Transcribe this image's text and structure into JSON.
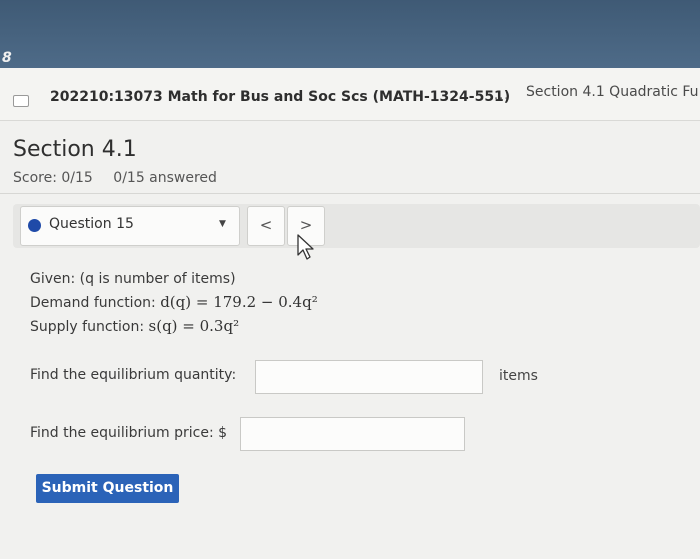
{
  "topbar": {
    "badge": "8"
  },
  "breadcrumb": {
    "course_title": "202210:13073 Math for Bus and Soc Scs (MATH-1324-551)",
    "dots": "...",
    "section": "Section 4.1 Quadratic Fu"
  },
  "page": {
    "title": "Section 4.1",
    "score": "Score: 0/15",
    "answered": "0/15 answered"
  },
  "question_nav": {
    "selected": "Question 15",
    "prev": "<",
    "next": ">"
  },
  "problem": {
    "given": "Given: (q is number of items)",
    "demand_label": "Demand function: ",
    "demand_expr": "d(q) = 179.2 − 0.4q²",
    "supply_label": "Supply function: ",
    "supply_expr": "s(q) = 0.3q²"
  },
  "answers": {
    "q1_label": "Find the equilibrium quantity:",
    "q1_value": "",
    "q1_unit": "items",
    "q2_label": "Find the equilibrium price: $",
    "q2_value": ""
  },
  "submit_label": "Submit Question",
  "colors": {
    "accent": "#2b63b8",
    "header": "#4e6b88",
    "question_dot": "#1f4aa8"
  },
  "icons": [
    "chevron-left-icon",
    "chevron-right-icon",
    "caret-down-icon",
    "mouse-cursor-icon"
  ]
}
